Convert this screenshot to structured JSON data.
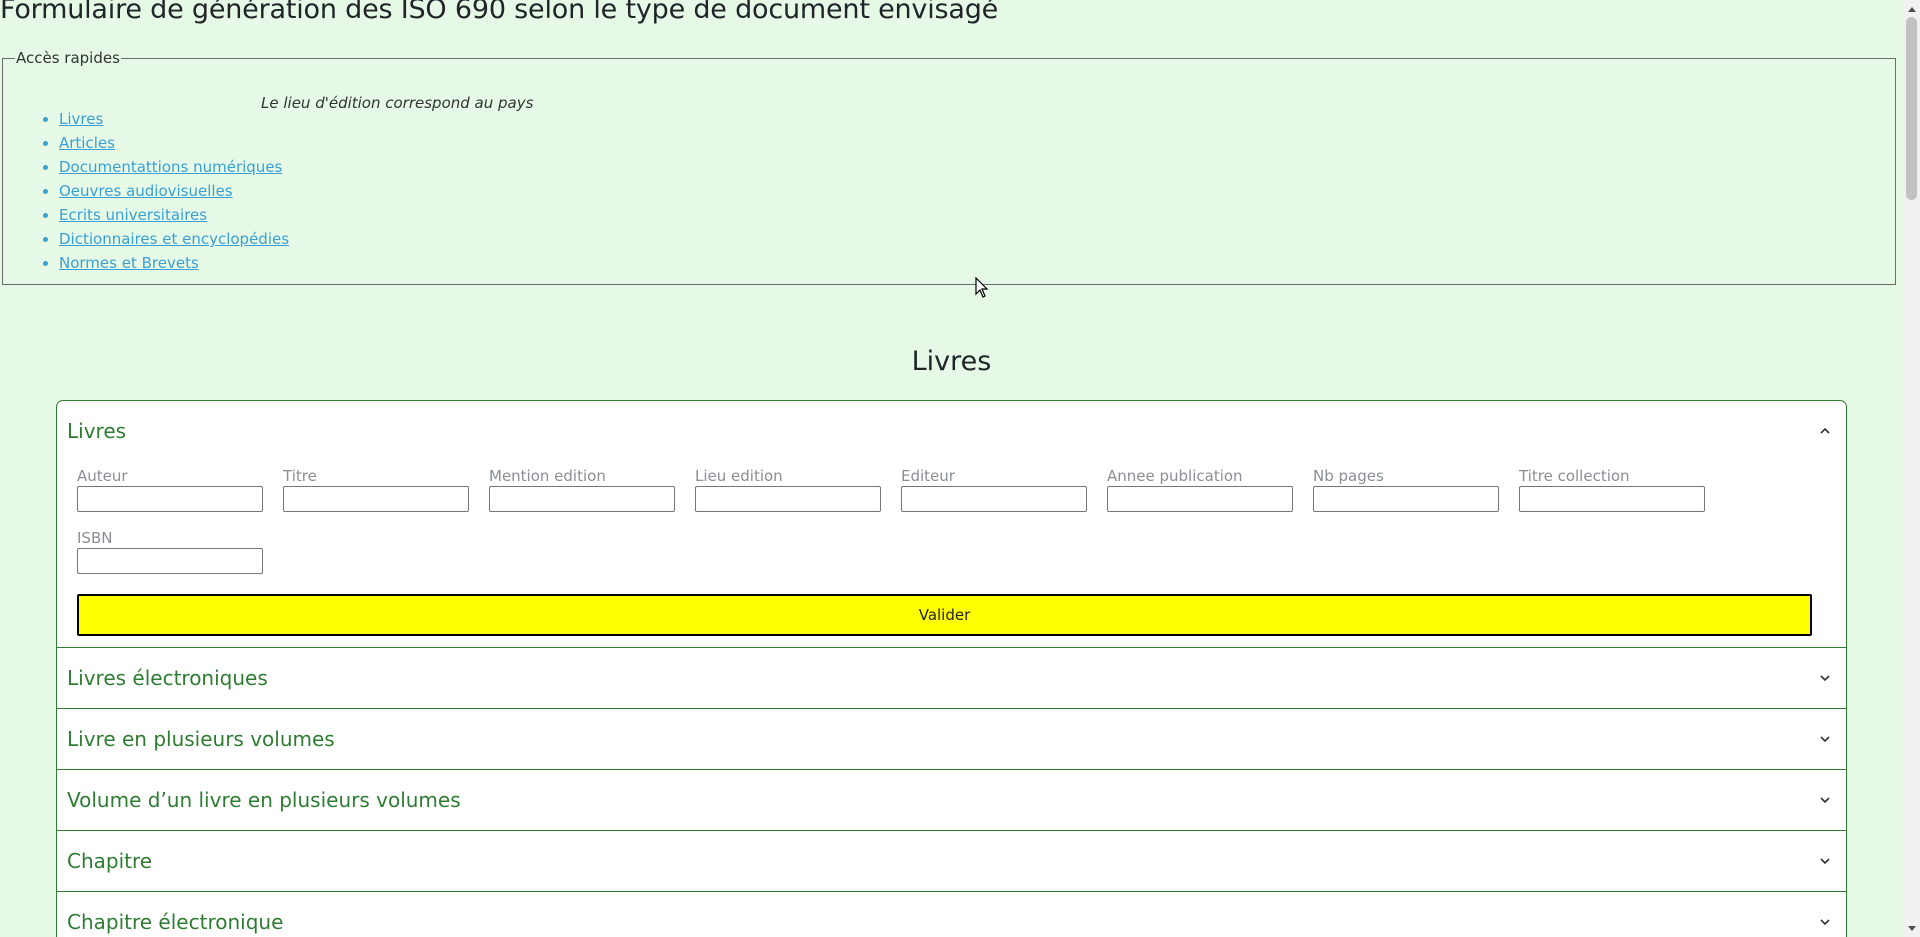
{
  "page_title": "Formulaire de génération des ISO 690 selon le type de document envisagé",
  "quick_access": {
    "legend": "Accès rapides",
    "note": "Le lieu d'édition correspond au pays",
    "links": [
      "Livres",
      "Articles",
      "Documentattions numériques",
      "Oeuvres audiovisuelles",
      "Ecrits universitaires",
      "Dictionnaires et encyclopédies",
      "Normes et Brevets"
    ]
  },
  "section_title": "Livres",
  "accordion": {
    "open_item": {
      "title": "Livres",
      "expanded": true,
      "fields": [
        {
          "label": "Auteur",
          "value": ""
        },
        {
          "label": "Titre",
          "value": ""
        },
        {
          "label": "Mention edition",
          "value": ""
        },
        {
          "label": "Lieu edition",
          "value": ""
        },
        {
          "label": "Editeur",
          "value": ""
        },
        {
          "label": "Annee publication",
          "value": ""
        },
        {
          "label": "Nb pages",
          "value": ""
        },
        {
          "label": "Titre collection",
          "value": ""
        },
        {
          "label": "ISBN",
          "value": ""
        }
      ],
      "submit_label": "Valider"
    },
    "collapsed_items": [
      "Livres électroniques",
      "Livre en plusieurs volumes",
      "Volume d’un livre en plusieurs volumes",
      "Chapitre",
      "Chapitre électronique"
    ]
  },
  "colors": {
    "background": "#e6f9e6",
    "accent": "#2e7d32",
    "link": "#3aa0d4",
    "submit": "#ffff00"
  },
  "icons": {
    "expanded": "chevron-up-icon",
    "collapsed": "chevron-down-icon"
  }
}
